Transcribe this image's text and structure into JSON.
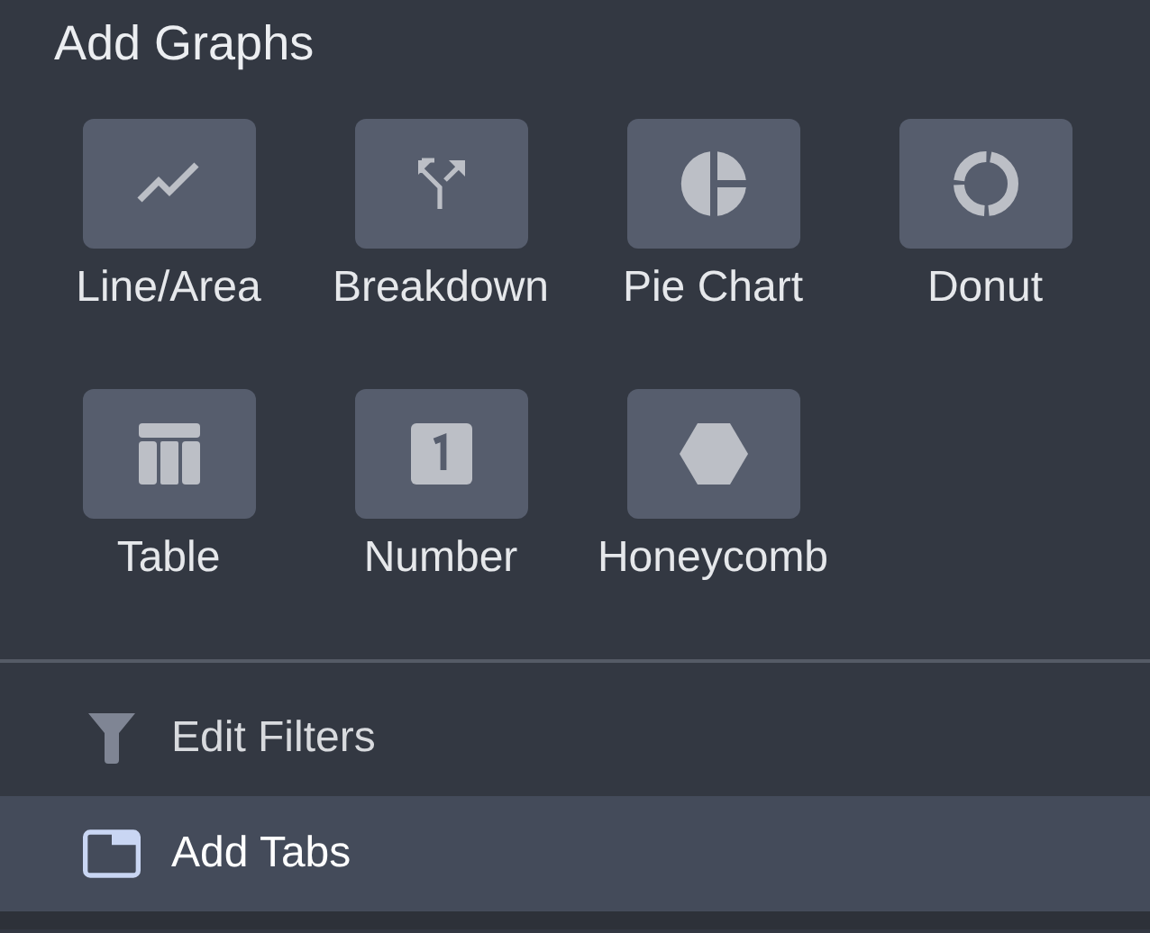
{
  "panel": {
    "title": "Add Graphs"
  },
  "graphs": [
    {
      "label": "Line/Area",
      "kind": "line"
    },
    {
      "label": "Breakdown",
      "kind": "split"
    },
    {
      "label": "Pie Chart",
      "kind": "pie"
    },
    {
      "label": "Donut",
      "kind": "donut"
    },
    {
      "label": "Table",
      "kind": "table"
    },
    {
      "label": "Number",
      "kind": "number"
    },
    {
      "label": "Honeycomb",
      "kind": "hexagon"
    }
  ],
  "menu": [
    {
      "label": "Edit Filters",
      "kind": "filter",
      "selected": false
    },
    {
      "label": "Add Tabs",
      "kind": "tab",
      "selected": true
    }
  ]
}
